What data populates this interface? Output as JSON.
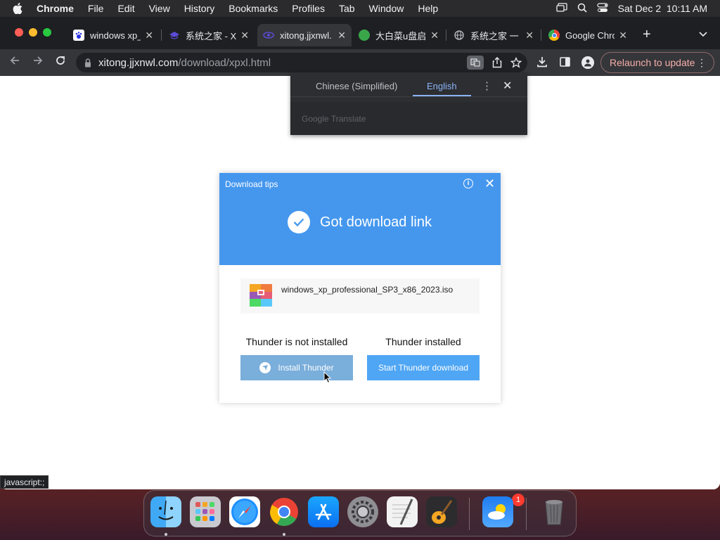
{
  "menubar": {
    "app": "Chrome",
    "items": [
      "File",
      "Edit",
      "View",
      "History",
      "Bookmarks",
      "Profiles",
      "Tab",
      "Window",
      "Help"
    ],
    "datetime": "Sat Dec 2  10:11 AM"
  },
  "tabs": [
    {
      "title": "windows xp_",
      "icon": "baidu-paw-icon"
    },
    {
      "title": "系统之家 - X",
      "icon": "graduation-cap-icon"
    },
    {
      "title": "xitong.jjxnwl.",
      "icon": "site-icon"
    },
    {
      "title": "大白菜u盘启",
      "icon": "cabbage-icon"
    },
    {
      "title": "系统之家 一",
      "icon": "globe-icon"
    },
    {
      "title": "Google Chro",
      "icon": "chrome-icon"
    }
  ],
  "toolbar": {
    "url_host": "xitong.jjxnwl.com",
    "url_path": "/download/xpxl.html",
    "relaunch_label": "Relaunch to update"
  },
  "translate_popup": {
    "source_lang": "Chinese (Simplified)",
    "target_lang": "English",
    "brand": "Google Translate"
  },
  "dialog": {
    "title": "Download tips",
    "headline": "Got download link",
    "filename": "windows_xp_professional_SP3_x86_2023.iso",
    "left_header": "Thunder is not installed",
    "right_header": "Thunder installed",
    "install_label": "Install Thunder",
    "start_label": "Start Thunder download"
  },
  "status_text": "javascript:;",
  "dock": {
    "apps": [
      "finder",
      "launchpad",
      "safari",
      "chrome",
      "app-store",
      "system-preferences",
      "textedit",
      "garageband",
      "weather",
      "trash"
    ],
    "settings_badge": "1"
  },
  "colors": {
    "dialog_header": "#4597ee",
    "install_button": "#7aaedb",
    "start_button": "#4fa6f4",
    "relaunch_text": "#f6aea9"
  }
}
